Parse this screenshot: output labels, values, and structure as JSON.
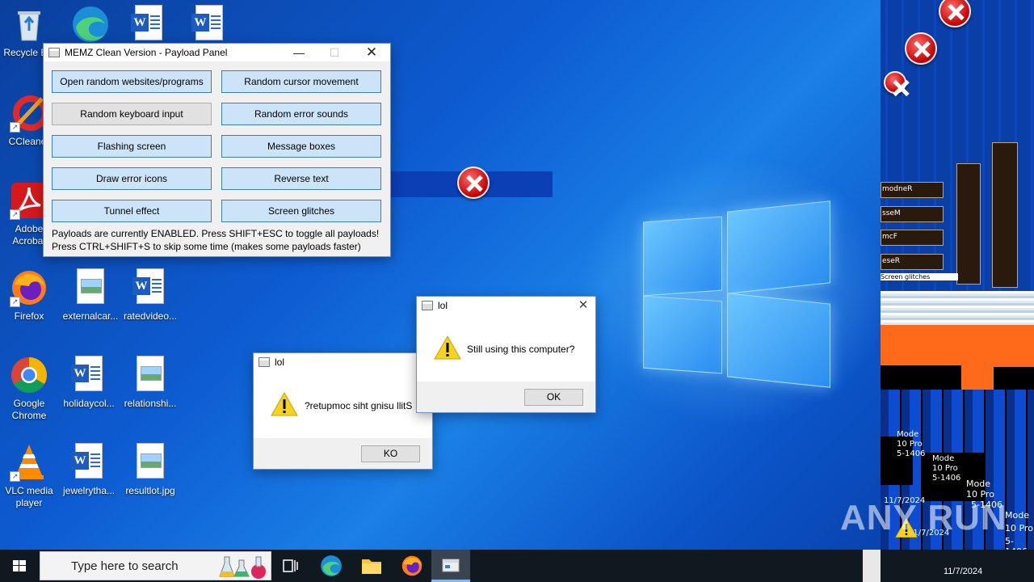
{
  "desktop": {
    "icons": [
      {
        "label": "Recycle Bin",
        "icon": "recycle-bin-icon"
      },
      {
        "label": "",
        "icon": "edge-icon"
      },
      {
        "label": "",
        "icon": "word-doc-icon"
      },
      {
        "label": "",
        "icon": "word-doc-icon"
      },
      {
        "label": "CCleaner",
        "icon": "ccleaner-icon"
      },
      {
        "label": "Adobe Acrobat",
        "icon": "acrobat-icon"
      },
      {
        "label": "Firefox",
        "icon": "firefox-icon"
      },
      {
        "label": "externalcar...",
        "icon": "image-file-icon"
      },
      {
        "label": "ratedvideo...",
        "icon": "word-doc-icon"
      },
      {
        "label": "Google Chrome",
        "icon": "chrome-icon"
      },
      {
        "label": "holidaycol...",
        "icon": "word-doc-icon"
      },
      {
        "label": "relationshi...",
        "icon": "image-file-icon"
      },
      {
        "label": "VLC media player",
        "icon": "vlc-icon"
      },
      {
        "label": "jewelrytha...",
        "icon": "word-doc-icon"
      },
      {
        "label": "resultlot.jpg",
        "icon": "image-file-icon"
      }
    ]
  },
  "panel": {
    "title": "MEMZ Clean Version - Payload Panel",
    "buttons": [
      {
        "label": "Open random websites/programs",
        "enabled": true
      },
      {
        "label": "Random cursor movement",
        "enabled": true
      },
      {
        "label": "Random keyboard input",
        "enabled": false
      },
      {
        "label": "Random error sounds",
        "enabled": true
      },
      {
        "label": "Flashing screen",
        "enabled": true
      },
      {
        "label": "Message boxes",
        "enabled": true
      },
      {
        "label": "Draw error icons",
        "enabled": true
      },
      {
        "label": "Reverse text",
        "enabled": true
      },
      {
        "label": "Tunnel effect",
        "enabled": true
      },
      {
        "label": "Screen glitches",
        "enabled": true
      }
    ],
    "status_line1": "Payloads are currently ENABLED. Press SHIFT+ESC to toggle all payloads!",
    "status_line2": "Press CTRL+SHIFT+S to skip some time (makes some payloads faster)"
  },
  "msgbox1": {
    "title": "lol",
    "message": "Still using this computer?",
    "button": "OK"
  },
  "msgbox2": {
    "title": "lol",
    "message": "?retupmoc siht gnisu llitS",
    "button": "KO"
  },
  "glitch": {
    "fragments": [
      "modneR",
      "sseM",
      "mcF",
      "eseR",
      "Screen glitches",
      "Mode",
      "10 Pro",
      "5-1406",
      "11/7/2024",
      "Mode",
      "10 Pro",
      "5-1406",
      "11/7/2024",
      "Mode",
      "10 Pro",
      "5-1406"
    ]
  },
  "taskbar": {
    "search_placeholder": "Type here to search",
    "clock": "11/7/2024"
  },
  "watermark": "ANY RUN",
  "colors": {
    "panel_button": "#cce4f7",
    "panel_button_border": "#3c7fb1",
    "desktop_blue": "#0d5bd1",
    "warning_yellow": "#f7d21e",
    "taskbar": "#101820"
  }
}
